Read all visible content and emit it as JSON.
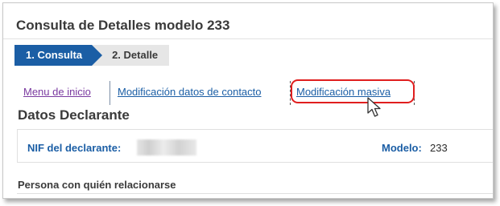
{
  "page": {
    "title": "Consulta de Detalles modelo 233"
  },
  "steps": [
    {
      "label": "1. Consulta",
      "active": true
    },
    {
      "label": "2. Detalle",
      "active": false
    }
  ],
  "nav": {
    "links": [
      {
        "label": "Menu de inicio",
        "visited": true
      },
      {
        "label": "Modificación datos de contacto",
        "visited": false
      },
      {
        "label": "Modificación masiva",
        "visited": false,
        "highlighted": true
      }
    ]
  },
  "section": {
    "title": "Datos Declarante"
  },
  "details": {
    "nif_label": "NIF del declarante:",
    "modelo_label": "Modelo:",
    "modelo_value": "233"
  },
  "persona": {
    "label": "Persona con quién relacionarse"
  },
  "colors": {
    "accent": "#1b5ea5",
    "highlight": "#e01e1e",
    "visited_link": "#7a3aa0"
  },
  "icons": {
    "cursor": "mouse-pointer-icon"
  }
}
